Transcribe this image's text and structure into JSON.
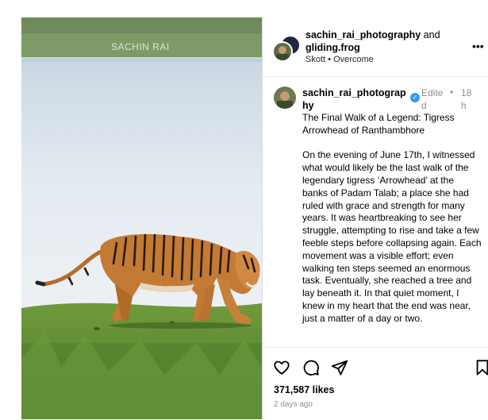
{
  "photo": {
    "watermark": "SACHIN RAI"
  },
  "header": {
    "user1": "sachin_rai_photography",
    "connector": "and",
    "user2": "gliding.frog",
    "audio_artist": "Skott",
    "separator": "•",
    "audio_track": "Overcome",
    "more_icon": "more-horizontal-icon"
  },
  "caption": {
    "username": "sachin_rai_photography",
    "edited": "Edited",
    "dot": "•",
    "time": "18h",
    "paragraph1": "The Final Walk of a Legend: Tigress Arrowhead of Ranthambhore",
    "paragraph2": "On the evening of June 17th, I witnessed what would likely be the last walk of the legendary tigress ‘Arrowhead’ at the banks of Padam Talab; a place she had ruled with grace and strength for many years. It was heartbreaking to see her struggle, attempting to rise and take a few feeble steps before collapsing again. Each movement was a visible effort; even walking ten steps seemed an enormous task. Eventually, she reached a tree and lay beneath it. In that quiet moment, I knew in my heart that the end was near, just a matter of a day or two."
  },
  "actions": {
    "icons": [
      "heart-icon",
      "comment-icon",
      "share-icon",
      "bookmark-icon"
    ],
    "likes": "371,587 likes",
    "date": "2 days ago"
  },
  "colors": {
    "verified": "#3897f0",
    "muted": "#8e8e8e",
    "divider": "#dbdbdb"
  }
}
